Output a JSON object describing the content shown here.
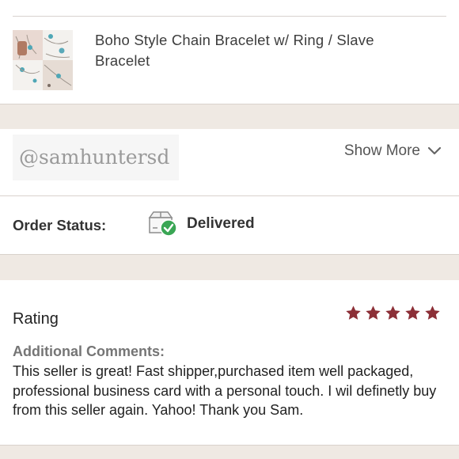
{
  "product": {
    "title": "Boho Style Chain Bracelet w/ Ring / Slave Bracelet",
    "thumbnail_icon": "bracelet-product-photo"
  },
  "seller": {
    "handle": "@samhuntersd",
    "show_more_label": "Show More",
    "show_more_icon": "chevron-down-icon"
  },
  "order": {
    "status_label": "Order Status:",
    "status_value": "Delivered",
    "status_icon": "package-delivered-icon"
  },
  "review": {
    "rating_label": "Rating",
    "stars": 5,
    "max_stars": 5,
    "comments_label": "Additional Comments:",
    "comments_text": "This seller is great! Fast shipper,purchased item well packaged, professional business card with a personal touch. I wil definetly buy from this seller again. Yahoo! Thank you Sam."
  },
  "colors": {
    "star": "#8c2f37",
    "check": "#3aa655",
    "background": "#efe9e3"
  }
}
